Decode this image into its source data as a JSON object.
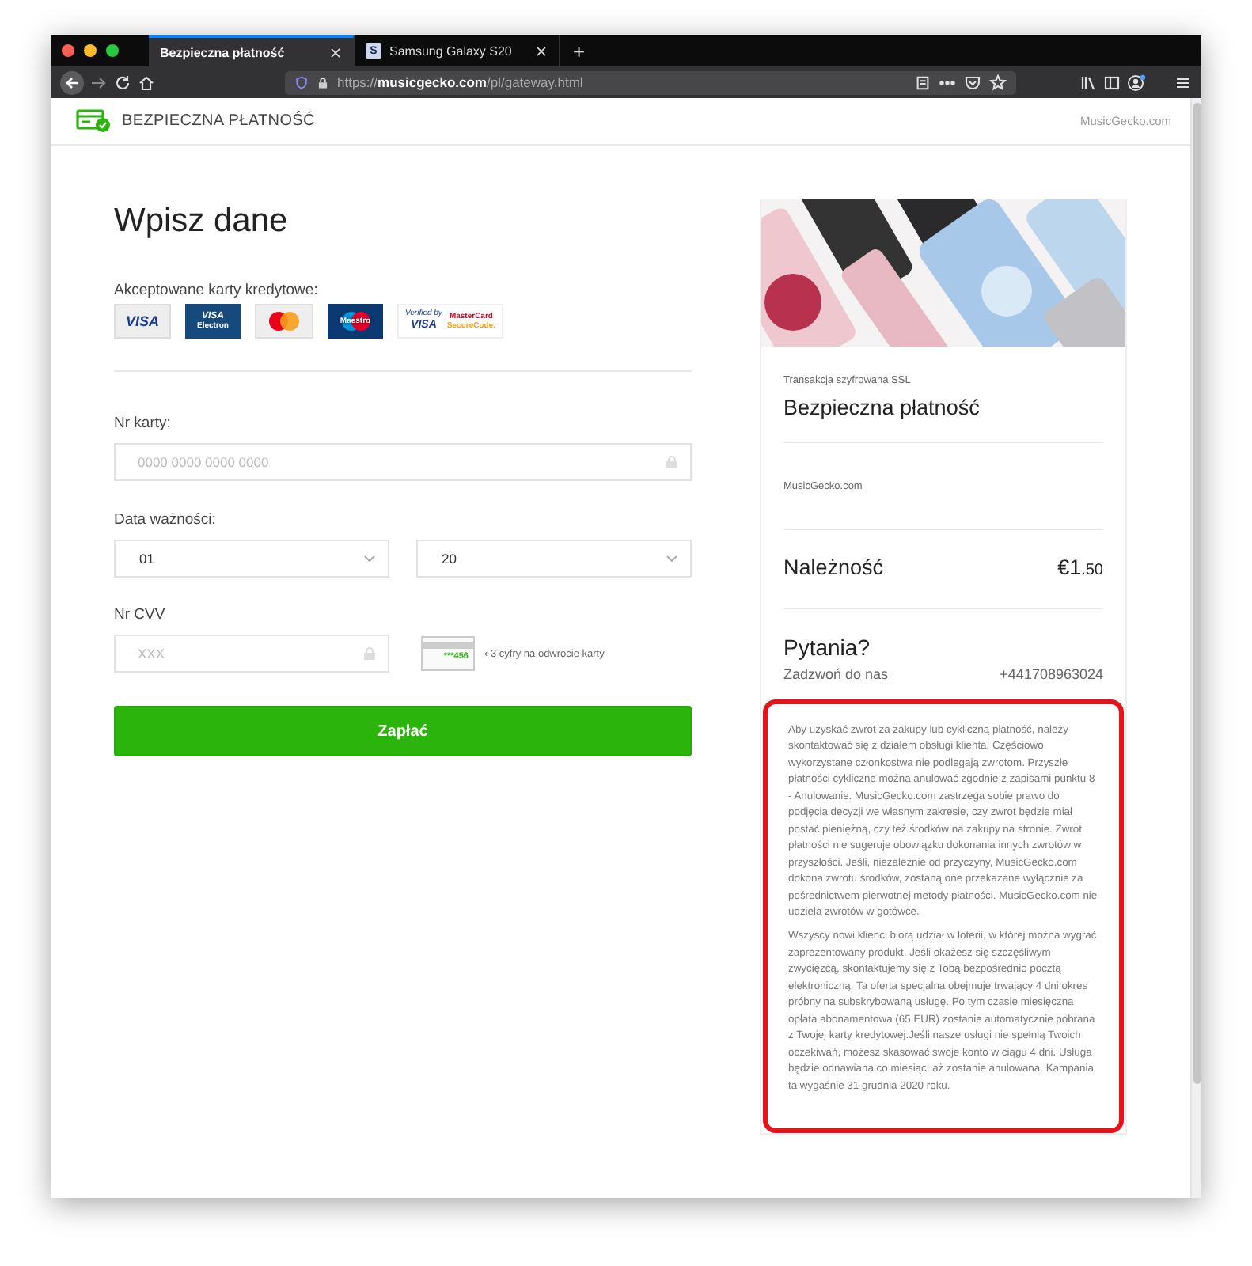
{
  "browser": {
    "tabs": [
      {
        "title": "Bezpieczna płatność",
        "selected": true,
        "kind": "plain"
      },
      {
        "title": "Samsung Galaxy S20",
        "selected": false,
        "kind": "favicon",
        "favicon": "S"
      }
    ],
    "new_tab": "+",
    "url": "https://**musicgecko.com**/pl/gateway.html"
  },
  "header": {
    "brand": "BEZPIECZNA PŁATNOŚĆ",
    "site": "MusicGecko.com"
  },
  "form": {
    "title": "Wpisz dane",
    "cards_label": "Akceptowane karty kredytowe:",
    "cards": [
      {
        "kind": "visa",
        "label": "VISA"
      },
      {
        "kind": "electron",
        "label": "VISA",
        "sublabel": "Electron"
      },
      {
        "kind": "mastercard"
      },
      {
        "kind": "maestro",
        "label": "Maestro"
      },
      {
        "kind": "secure",
        "label": "Verified by",
        "sublabel": "VISA",
        "label2": "MasterCard",
        "sublabel2": "SecureCode."
      }
    ],
    "card_number": {
      "label": "Nr karty:",
      "placeholder": "0000 0000 0000 0000"
    },
    "expiry": {
      "label": "Data ważności:",
      "month": "01",
      "year": "20"
    },
    "cvv": {
      "label": "Nr CVV",
      "placeholder": "XXX",
      "card_digits": "***456",
      "hint": "‹ 3 cyfry na odwrocie karty"
    },
    "submit": "Zapłać"
  },
  "summary": {
    "ssl_note": "Transakcja szyfrowana SSL",
    "title": "Bezpieczna płatność",
    "merchant": "MusicGecko.com",
    "amount_label": "Należność",
    "amount": "€1",
    "amount_fraction": ".50",
    "questions_title": "Pytania?",
    "call_label": "Zadzwoń do nas",
    "phone": "+441708963024",
    "terms": {
      "highlighted": true,
      "paragraphs": [
        "Aby uzyskać zwrot za zakupy lub cykliczną płatność, należy skontaktować się z działem obsługi klienta. Częściowo wykorzystane członkostwa nie podlegają zwrotom. Przyszłe płatności cykliczne można anulować zgodnie z zapisami punktu 8 - Anulowanie. MusicGecko.com zastrzega sobie prawo do podjęcia decyzji we własnym zakresie, czy zwrot będzie miał postać pieniężną, czy też środków na zakupy na stronie. Zwrot płatności nie sugeruje obowiązku dokonania innych zwrotów w przyszłości. Jeśli, niezależnie od przyczyny, MusicGecko.com dokona zwrotu środków, zostaną one przekazane wyłącznie za pośrednictwem pierwotnej metody płatności. MusicGecko.com nie udziela zwrotów w gotówce.",
        "Wszyscy nowi klienci biorą udział w loterii, w której można wygrać zaprezentowany produkt. Jeśli okażesz się szczęśliwym zwycięzcą, skontaktujemy się z Tobą bezpośrednio pocztą elektroniczną. Ta oferta specjalna obejmuje trwający 4 dni okres próbny na subskrybowaną usługę. Po tym czasie miesięczna opłata abonamentowa (65 EUR) zostanie automatycznie pobrana z Twojej karty kredytowej.Jeśli nasze usługi nie spełnią Twoich oczekiwań, możesz skasować swoje konto w ciągu 4 dni. Usługa będzie odnawiana co miesiąc, aż zostanie anulowana. Kampania ta wygaśnie 31 grudnia 2020 roku."
      ]
    }
  }
}
